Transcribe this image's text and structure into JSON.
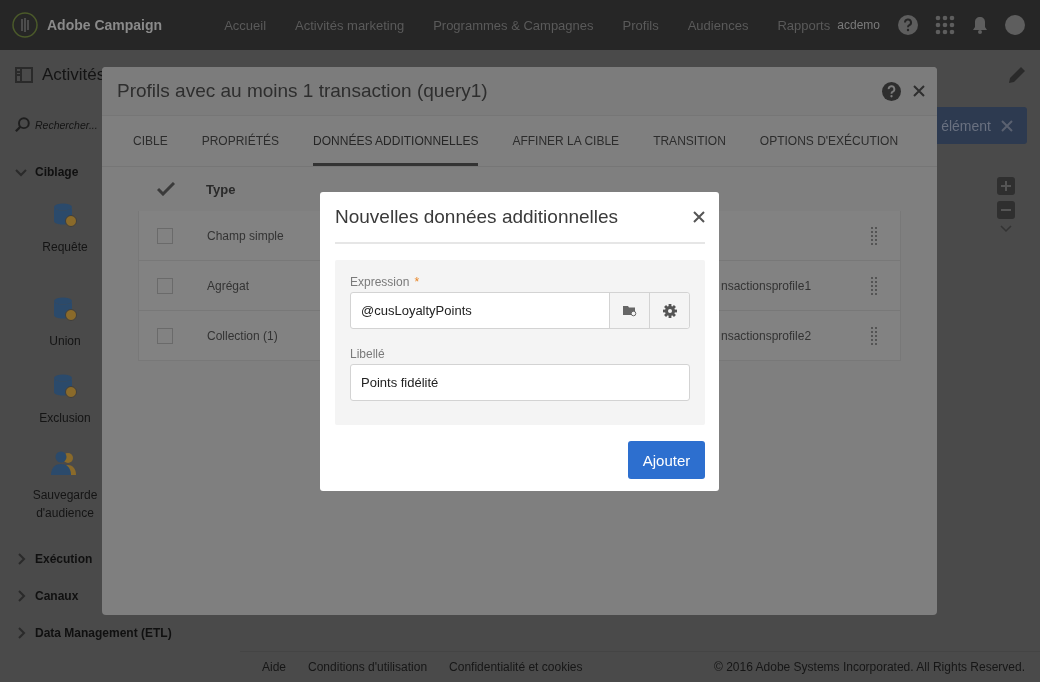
{
  "header": {
    "app_name": "Adobe Campaign",
    "nav": [
      {
        "label": "Accueil"
      },
      {
        "label": "Activités marketing"
      },
      {
        "label": "Programmes & Campagnes"
      },
      {
        "label": "Profils"
      },
      {
        "label": "Audiences"
      },
      {
        "label": "Rapports"
      }
    ],
    "user": "acdemo"
  },
  "sidebar": {
    "title": "Activités",
    "search": {
      "placeholder": "Rechercher..."
    },
    "groups": [
      {
        "label": "Ciblage",
        "expanded": true,
        "items": [
          {
            "label": "Requête",
            "kind": "database"
          },
          {
            "label": "Union",
            "kind": "database"
          },
          {
            "label": "Exclusion",
            "kind": "database"
          },
          {
            "label": "Sauvegarde d'audience",
            "kind": "audience"
          }
        ]
      },
      {
        "label": "Exécution",
        "expanded": false
      },
      {
        "label": "Canaux",
        "expanded": false
      },
      {
        "label": "Data Management (ETL)",
        "expanded": false
      }
    ]
  },
  "toolbar": {
    "button": "élément"
  },
  "query_dialog": {
    "title": "Profils avec au moins 1 transaction (query1)",
    "tabs": [
      {
        "label": "CIBLE",
        "selected": false
      },
      {
        "label": "PROPRIÉTÉS",
        "selected": false
      },
      {
        "label": "DONNÉES ADDITIONNELLES",
        "selected": true
      },
      {
        "label": "AFFINER LA CIBLE",
        "selected": false
      },
      {
        "label": "TRANSITION",
        "selected": false
      },
      {
        "label": "OPTIONS D'EXÉCUTION",
        "selected": false
      }
    ],
    "table": {
      "columns": [
        "Type"
      ],
      "rows": [
        {
          "checked": false,
          "type": "Champ simple"
        },
        {
          "checked": false,
          "type": "Agrégat",
          "alias": "nsactionsprofile1"
        },
        {
          "checked": false,
          "type": "Collection (1)",
          "alias": "nsactionsprofile2"
        }
      ]
    }
  },
  "add_dialog": {
    "title": "Nouvelles données additionnelles",
    "fields": [
      {
        "kind": "expression",
        "label": "Expression",
        "required_mark": "*",
        "value": "@cusLoyaltyPoints"
      },
      {
        "kind": "text",
        "label": "Libellé",
        "value": "Points fidélité"
      }
    ],
    "button": "Ajouter"
  },
  "footer": {
    "links": [
      "Aide",
      "Conditions d'utilisation",
      "Confidentialité et cookies"
    ],
    "copyright": "© 2016 Adobe Systems Incorporated. All Rights Reserved."
  }
}
